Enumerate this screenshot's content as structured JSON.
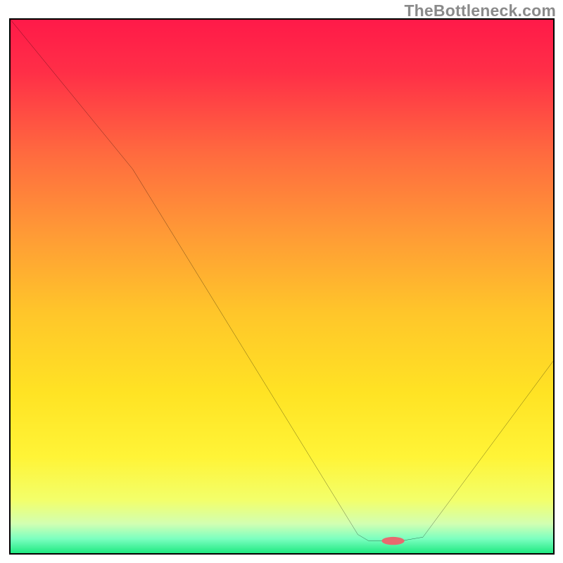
{
  "watermark": "TheBottleneck.com",
  "chart_data": {
    "type": "line",
    "title": "",
    "xlabel": "",
    "ylabel": "",
    "xlim": [
      0,
      100
    ],
    "ylim": [
      0,
      100
    ],
    "series": [
      {
        "name": "curve",
        "points": [
          [
            0,
            100
          ],
          [
            22.5,
            72
          ],
          [
            64,
            3.5
          ],
          [
            66,
            2.3
          ],
          [
            72,
            2.3
          ],
          [
            76,
            3.0
          ],
          [
            100,
            36
          ]
        ]
      }
    ],
    "marker": {
      "x": 70.5,
      "y": 2.3,
      "rx": 2.1,
      "ry": 0.75,
      "color": "#e76a6f"
    },
    "gradient_stops": [
      {
        "offset": 0.0,
        "color": "#ff1a49"
      },
      {
        "offset": 0.1,
        "color": "#ff2f47"
      },
      {
        "offset": 0.25,
        "color": "#ff6a3f"
      },
      {
        "offset": 0.4,
        "color": "#ff9a36"
      },
      {
        "offset": 0.55,
        "color": "#ffc62a"
      },
      {
        "offset": 0.7,
        "color": "#ffe324"
      },
      {
        "offset": 0.82,
        "color": "#fff437"
      },
      {
        "offset": 0.9,
        "color": "#f3ff6a"
      },
      {
        "offset": 0.945,
        "color": "#d2ffb2"
      },
      {
        "offset": 0.973,
        "color": "#7cffc0"
      },
      {
        "offset": 1.0,
        "color": "#1fe981"
      }
    ]
  }
}
